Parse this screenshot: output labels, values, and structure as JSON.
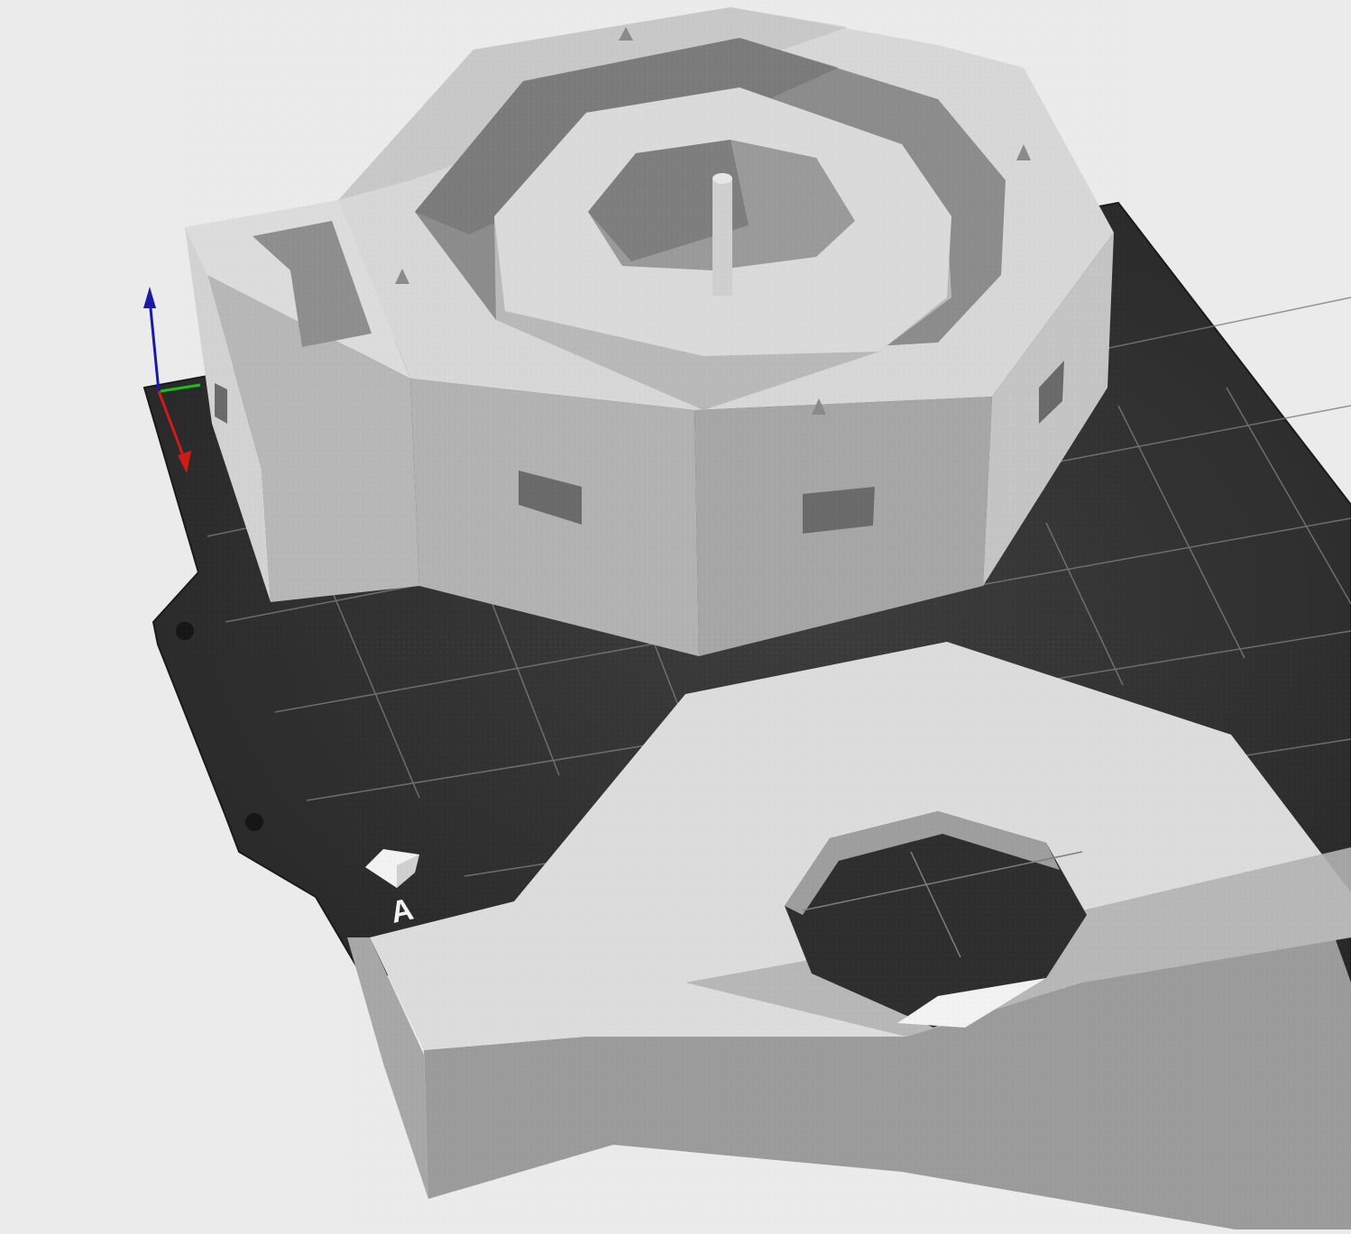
{
  "viewport": {
    "background_color": "#ebebeb",
    "bed_color": "#2b2b2b",
    "bed_edge_color": "#1a1a1a",
    "grid_color": "#8a8a8a",
    "model_light_color": "#dadada",
    "model_mid_color": "#bdbdbd",
    "model_shadow_color": "#9c9c9c",
    "model_dark_color": "#7a7a7a"
  },
  "axes": {
    "x_color": "#d11a1a",
    "y_color": "#1bbf1b",
    "z_color": "#1a1aa8"
  },
  "bed_logo": {
    "icon": "printer-bed-logo-icon",
    "text": "A"
  },
  "objects": [
    {
      "name": "octagonal-bunker-model"
    },
    {
      "name": "bunker-roof-slab-model"
    }
  ]
}
